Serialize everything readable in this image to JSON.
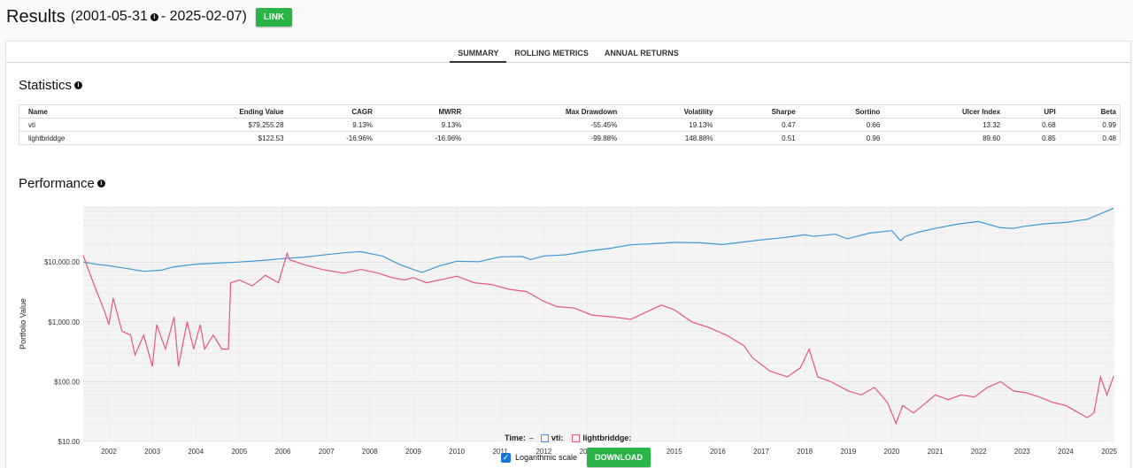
{
  "header": {
    "title": "Results",
    "date_start": "(2001-05-31",
    "date_end": "- 2025-02-07)",
    "link_label": "LINK"
  },
  "tabs": [
    {
      "label": "SUMMARY",
      "active": true
    },
    {
      "label": "ROLLING METRICS",
      "active": false
    },
    {
      "label": "ANNUAL RETURNS",
      "active": false
    }
  ],
  "statistics": {
    "title": "Statistics",
    "columns": [
      "Name",
      "Ending Value",
      "CAGR",
      "MWRR",
      "Max Drawdown",
      "Volatility",
      "Sharpe",
      "Sortino",
      "Ulcer Index",
      "UPI",
      "Beta"
    ],
    "rows": [
      [
        "vti",
        "$79,255.28",
        "9.13%",
        "9.13%",
        "-55.45%",
        "19.13%",
        "0.47",
        "0.66",
        "13.32",
        "0.68",
        "0.99"
      ],
      [
        "lightbriddge",
        "$122.53",
        "-16.96%",
        "-16.96%",
        "-99.88%",
        "148.88%",
        "0.51",
        "0.96",
        "89.60",
        "0.85",
        "0.48"
      ]
    ]
  },
  "performance": {
    "title": "Performance"
  },
  "legend": {
    "time_label": "Time:",
    "time_value": "–",
    "series": [
      {
        "label": "vti:",
        "color": "#3a9bd5"
      },
      {
        "label": "lightbriddge:",
        "color": "#e8577a"
      }
    ]
  },
  "controls": {
    "log_scale_label": "Logarithmic scale",
    "log_scale_checked": true,
    "download_label": "DOWNLOAD"
  },
  "chart_data": {
    "type": "line",
    "ylabel": "Portfolio Value",
    "xlabel": "",
    "log_scale": true,
    "ylim": [
      10,
      80000
    ],
    "x_ticks": [
      "2002",
      "2003",
      "2004",
      "2005",
      "2006",
      "2007",
      "2008",
      "2009",
      "2010",
      "2011",
      "2012",
      "2013",
      "2014",
      "2015",
      "2016",
      "2017",
      "2018",
      "2019",
      "2020",
      "2021",
      "2022",
      "2023",
      "2024",
      "2025"
    ],
    "y_ticks": [
      {
        "value": 10,
        "label": "$10.00"
      },
      {
        "value": 100,
        "label": "$100.00"
      },
      {
        "value": 1000,
        "label": "$1,000.00"
      },
      {
        "value": 10000,
        "label": "$10,000.00"
      }
    ],
    "series": [
      {
        "name": "vti",
        "color": "#3a9bd5",
        "x": [
          2001.41,
          2001.7,
          2002.0,
          2002.5,
          2002.8,
          2003.2,
          2003.5,
          2004.0,
          2004.5,
          2005.0,
          2005.5,
          2006.0,
          2006.5,
          2007.0,
          2007.5,
          2007.8,
          2008.3,
          2008.7,
          2009.0,
          2009.2,
          2009.6,
          2010.0,
          2010.5,
          2011.0,
          2011.5,
          2011.7,
          2012.0,
          2012.5,
          2013.0,
          2013.5,
          2014.0,
          2014.5,
          2015.0,
          2015.6,
          2016.1,
          2016.5,
          2017.0,
          2017.5,
          2018.0,
          2018.2,
          2018.7,
          2018.98,
          2019.5,
          2020.0,
          2020.2,
          2020.3,
          2020.6,
          2021.0,
          2021.5,
          2021.99,
          2022.5,
          2022.8,
          2023.0,
          2023.5,
          2024.0,
          2024.5,
          2025.1
        ],
        "values": [
          10000,
          9200,
          8700,
          7600,
          7000,
          7300,
          8300,
          9200,
          9600,
          10000,
          10600,
          11400,
          12100,
          13300,
          14500,
          14900,
          12500,
          9000,
          7500,
          6700,
          8600,
          10300,
          10100,
          12200,
          12400,
          11000,
          12600,
          13200,
          15200,
          16800,
          19400,
          20200,
          21300,
          21000,
          19600,
          21200,
          23500,
          25500,
          28500,
          26800,
          29200,
          24500,
          30500,
          33500,
          22800,
          26500,
          31500,
          36500,
          43000,
          47500,
          37500,
          36500,
          39000,
          43500,
          46000,
          52000,
          79255
        ]
      },
      {
        "name": "lightbriddge",
        "color": "#e8577a",
        "x": [
          2001.41,
          2001.5,
          2001.7,
          2001.9,
          2002.0,
          2002.1,
          2002.3,
          2002.5,
          2002.6,
          2002.8,
          2003.0,
          2003.1,
          2003.3,
          2003.5,
          2003.6,
          2003.8,
          2003.95,
          2004.1,
          2004.2,
          2004.4,
          2004.6,
          2004.75,
          2004.8,
          2005.0,
          2005.3,
          2005.6,
          2005.9,
          2006.1,
          2006.15,
          2006.5,
          2006.9,
          2007.4,
          2007.8,
          2008.2,
          2008.5,
          2008.8,
          2009.0,
          2009.3,
          2009.7,
          2010.0,
          2010.4,
          2010.8,
          2011.2,
          2011.6,
          2012.0,
          2012.3,
          2012.7,
          2013.1,
          2013.6,
          2014.0,
          2014.3,
          2014.7,
          2015.0,
          2015.4,
          2015.8,
          2016.2,
          2016.6,
          2016.8,
          2017.2,
          2017.6,
          2017.9,
          2018.1,
          2018.3,
          2018.6,
          2019.0,
          2019.3,
          2019.6,
          2019.9,
          2020.1,
          2020.25,
          2020.5,
          2020.8,
          2021.0,
          2021.3,
          2021.6,
          2021.9,
          2022.2,
          2022.5,
          2022.8,
          2023.1,
          2023.4,
          2023.7,
          2024.0,
          2024.3,
          2024.5,
          2024.65,
          2024.8,
          2024.95,
          2025.1
        ],
        "values": [
          13000,
          8500,
          3500,
          1500,
          900,
          2500,
          700,
          600,
          280,
          600,
          180,
          900,
          350,
          1200,
          180,
          1000,
          350,
          900,
          350,
          600,
          350,
          350,
          4500,
          5000,
          4000,
          6000,
          4500,
          14000,
          11000,
          9000,
          7500,
          6500,
          7500,
          6500,
          5500,
          5000,
          5500,
          4500,
          5200,
          5800,
          4500,
          4200,
          3500,
          3200,
          2200,
          1800,
          1700,
          1300,
          1200,
          1100,
          1400,
          1900,
          1600,
          1000,
          800,
          600,
          400,
          250,
          150,
          120,
          170,
          350,
          120,
          100,
          70,
          60,
          80,
          45,
          20,
          40,
          30,
          45,
          60,
          50,
          60,
          55,
          80,
          100,
          70,
          65,
          55,
          45,
          40,
          30,
          25,
          30,
          120,
          60,
          122.53
        ]
      }
    ]
  }
}
